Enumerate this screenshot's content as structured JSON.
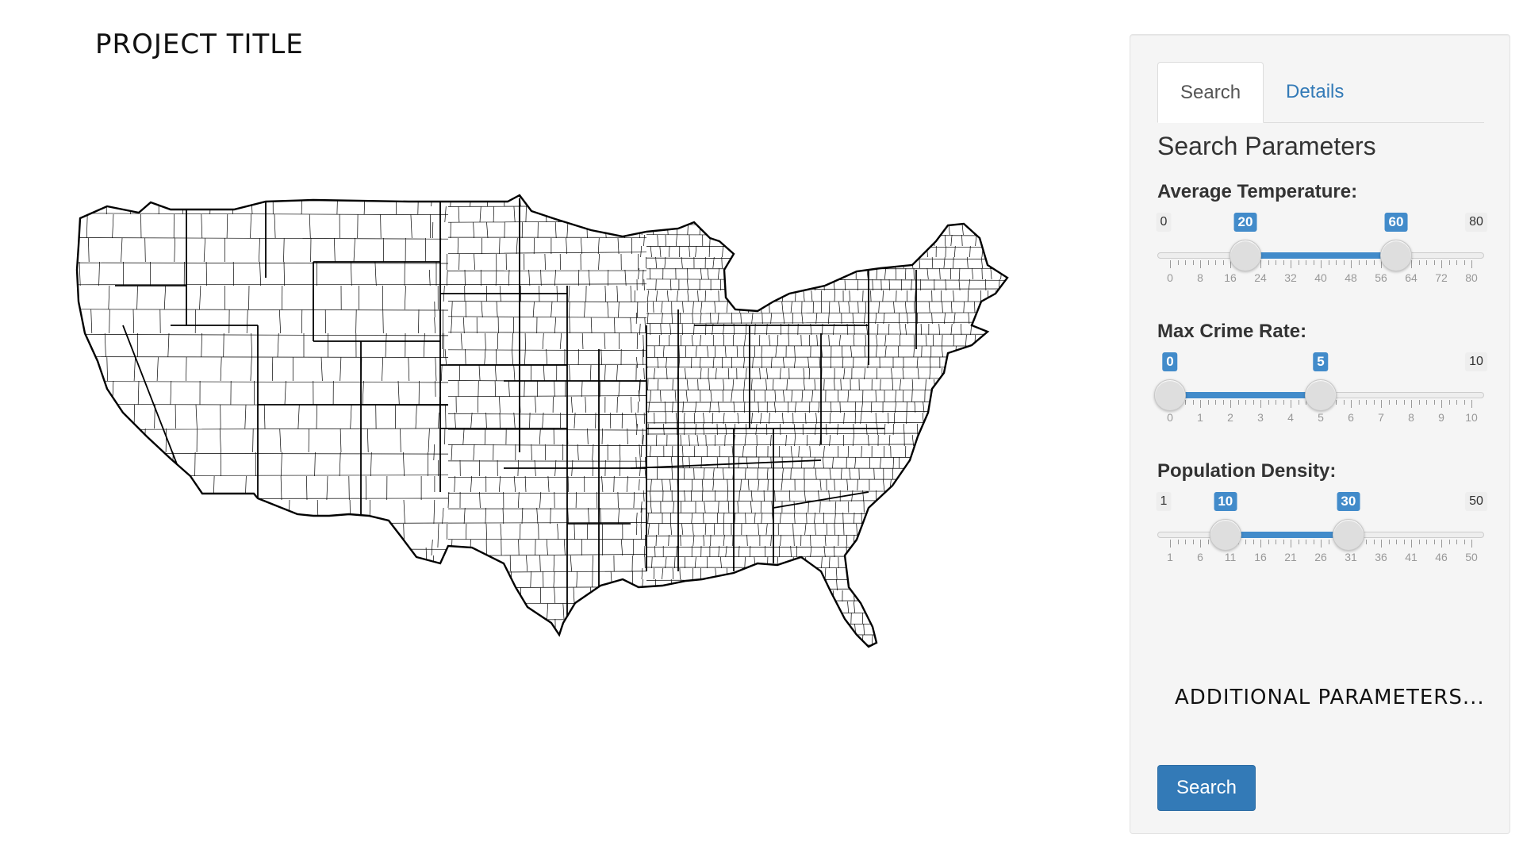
{
  "header": {
    "title": "PROJECT TITLE"
  },
  "map": {
    "description_icon": "us-county-map",
    "stroke_color": "#000000",
    "fill_color": "#ffffff"
  },
  "panel": {
    "tabs": [
      {
        "label": "Search",
        "active": true
      },
      {
        "label": "Details",
        "active": false
      }
    ],
    "section_title": "Search Parameters",
    "sliders": [
      {
        "label": "Average Temperature:",
        "min": 0,
        "max": 80,
        "low": 20,
        "high": 60,
        "min_label": "0",
        "max_label": "80",
        "low_label": "20",
        "high_label": "60",
        "ticks": [
          "0",
          "8",
          "16",
          "24",
          "32",
          "40",
          "48",
          "56",
          "64",
          "72",
          "80"
        ]
      },
      {
        "label": "Max Crime Rate:",
        "min": 0,
        "max": 10,
        "low": 0,
        "high": 5,
        "min_label": "",
        "max_label": "10",
        "low_label": "0",
        "high_label": "5",
        "ticks": [
          "0",
          "1",
          "2",
          "3",
          "4",
          "5",
          "6",
          "7",
          "8",
          "9",
          "10"
        ]
      },
      {
        "label": "Population Density:",
        "min": 1,
        "max": 50,
        "low": 10,
        "high": 30,
        "min_label": "1",
        "max_label": "50",
        "low_label": "10",
        "high_label": "30",
        "ticks": [
          "1",
          "6",
          "11",
          "16",
          "21",
          "26",
          "31",
          "36",
          "41",
          "46",
          "50"
        ]
      }
    ],
    "additional_text": "ADDITIONAL PARAMETERS...",
    "search_button": "Search",
    "accent_color": "#428bca"
  }
}
